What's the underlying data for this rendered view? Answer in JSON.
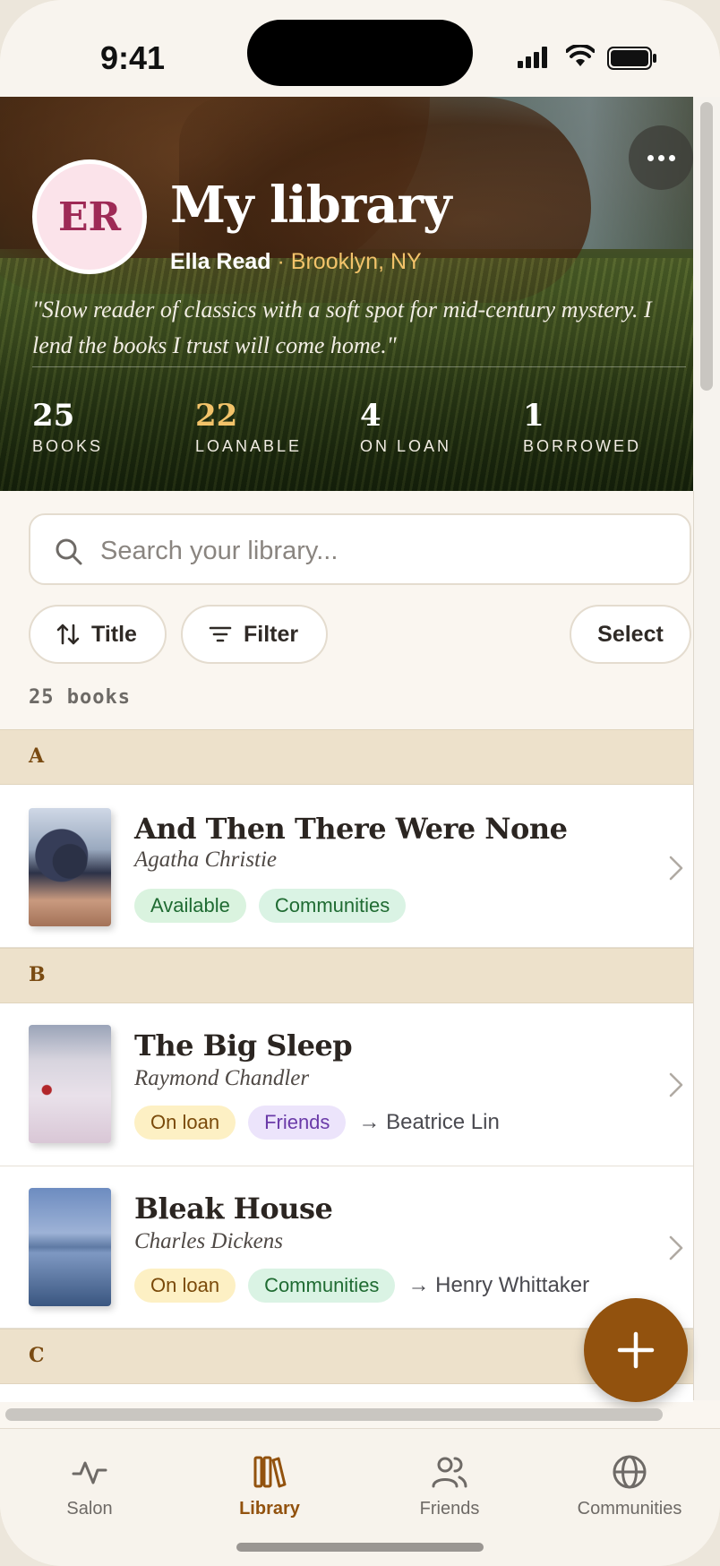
{
  "status_bar": {
    "time": "9:41"
  },
  "header": {
    "title": "My library",
    "avatar_initials": "ER",
    "owner_name": "Ella Read",
    "separator": "·",
    "location": "Brooklyn, NY",
    "bio": "\"Slow reader of classics with a soft spot for mid-century mystery. I lend the books I trust will come home.\"",
    "stats": [
      {
        "value": "25",
        "label": "BOOKS"
      },
      {
        "value": "22",
        "label": "LOANABLE"
      },
      {
        "value": "4",
        "label": "ON LOAN"
      },
      {
        "value": "1",
        "label": "BORROWED"
      }
    ]
  },
  "search": {
    "placeholder": "Search your library..."
  },
  "toolbar": {
    "sort_label": "Title",
    "filter_label": "Filter",
    "select_label": "Select"
  },
  "book_count": "25  books",
  "sections": [
    {
      "letter": "A",
      "books": [
        {
          "title": "And Then There Were None",
          "author": "Agatha Christie",
          "status": "Available",
          "visibility": "Communities",
          "loaned_to": ""
        }
      ]
    },
    {
      "letter": "B",
      "books": [
        {
          "title": "The Big Sleep",
          "author": "Raymond Chandler",
          "status": "On loan",
          "visibility": "Friends",
          "loaned_to": "→ Beatrice Lin"
        },
        {
          "title": "Bleak House",
          "author": "Charles Dickens",
          "status": "On loan",
          "visibility": "Communities",
          "loaned_to": "→ Henry Whittaker"
        }
      ]
    },
    {
      "letter": "C",
      "books": []
    }
  ],
  "tab_bar": {
    "items": [
      {
        "label": "Salon",
        "icon": "activity-icon"
      },
      {
        "label": "Library",
        "icon": "books-icon",
        "active": true
      },
      {
        "label": "Friends",
        "icon": "users-icon"
      },
      {
        "label": "Communities",
        "icon": "globe-icon"
      }
    ]
  },
  "colors": {
    "accent": "#92520e",
    "gold": "#f3c36a",
    "section_bg": "#ede1cb"
  }
}
